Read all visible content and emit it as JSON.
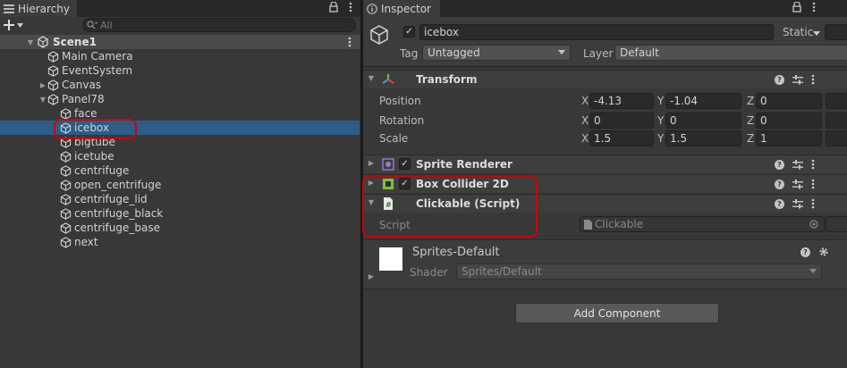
{
  "hierarchy": {
    "tab_label": "Hierarchy",
    "search_placeholder": "All",
    "scene_name": "Scene1",
    "items": [
      {
        "label": "Main Camera",
        "indent": 1,
        "expandable": false
      },
      {
        "label": "EventSystem",
        "indent": 1,
        "expandable": false
      },
      {
        "label": "Canvas",
        "indent": 1,
        "expandable": true
      },
      {
        "label": "Panel78",
        "indent": 1,
        "expandable": true,
        "expanded": true
      },
      {
        "label": "face",
        "indent": 2,
        "expandable": false
      },
      {
        "label": "icebox",
        "indent": 2,
        "expandable": false,
        "selected": true
      },
      {
        "label": "bigtube",
        "indent": 2,
        "expandable": false
      },
      {
        "label": "icetube",
        "indent": 2,
        "expandable": false
      },
      {
        "label": "centrifuge",
        "indent": 2,
        "expandable": false
      },
      {
        "label": "open_centrifuge",
        "indent": 2,
        "expandable": false
      },
      {
        "label": "centrifuge_lid",
        "indent": 2,
        "expandable": false
      },
      {
        "label": "centrifuge_black",
        "indent": 2,
        "expandable": false
      },
      {
        "label": "centrifuge_base",
        "indent": 2,
        "expandable": false
      },
      {
        "label": "next",
        "indent": 2,
        "expandable": false
      }
    ]
  },
  "inspector": {
    "tab_label": "Inspector",
    "object_name": "icebox",
    "static_label": "Static",
    "tag_label": "Tag",
    "tag_value": "Untagged",
    "layer_label": "Layer",
    "layer_value": "Default",
    "transform": {
      "title": "Transform",
      "position_label": "Position",
      "rotation_label": "Rotation",
      "scale_label": "Scale",
      "x_label": "X",
      "y_label": "Y",
      "z_label": "Z",
      "position": {
        "x": "-4.13",
        "y": "-1.04",
        "z": "0"
      },
      "rotation": {
        "x": "0",
        "y": "0",
        "z": "0"
      },
      "scale": {
        "x": "1.5",
        "y": "1.5",
        "z": "1"
      }
    },
    "sprite_renderer": {
      "title": "Sprite Renderer"
    },
    "box_collider": {
      "title": "Box Collider 2D"
    },
    "clickable": {
      "title": "Clickable (Script)",
      "script_label": "Script",
      "script_value": "Clickable"
    },
    "material": {
      "name": "Sprites-Default",
      "shader_label": "Shader",
      "shader_value": "Sprites/Default"
    },
    "add_component_label": "Add Component"
  },
  "colors": {
    "selection": "#2c5d87",
    "highlight_box": "#d00000",
    "panel_bg": "#383838"
  }
}
